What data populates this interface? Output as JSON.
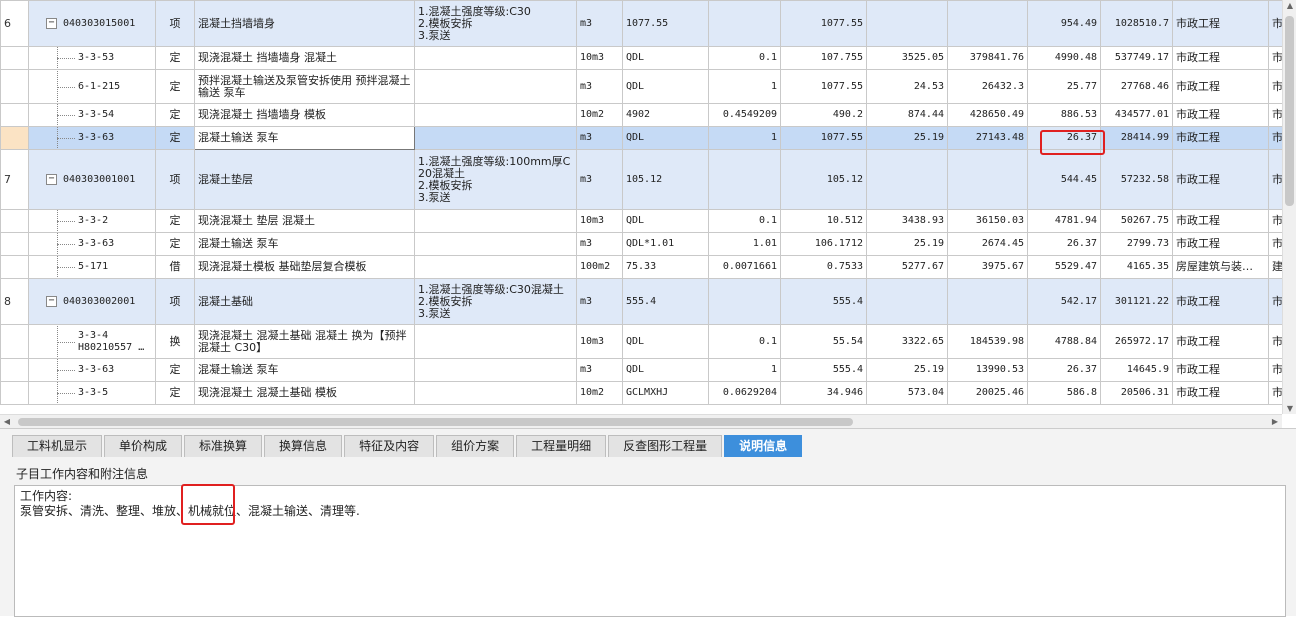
{
  "grid": {
    "rows": [
      {
        "type": "item",
        "rownum": "6",
        "code": "040303015001",
        "kind": "项",
        "name": "混凝土挡墙墙身",
        "features": "1.混凝土强度等级:C30\n2.模板安拆\n3.泵送",
        "unit": "m3",
        "qexpr": "1077.55",
        "coeff": "",
        "qty": "1077.55",
        "price": "",
        "total": "",
        "uprice": "954.49",
        "utotal": "1028510.7",
        "spec": "市政工程",
        "extra": "市"
      },
      {
        "type": "child",
        "rownum": "",
        "code": "3-3-53",
        "kind": "定",
        "name": "现浇混凝土 挡墙墙身 混凝土",
        "features": "",
        "unit": "10m3",
        "qexpr": "QDL",
        "coeff": "0.1",
        "qty": "107.755",
        "price": "3525.05",
        "total": "379841.76",
        "uprice": "4990.48",
        "utotal": "537749.17",
        "spec": "市政工程",
        "extra": "市"
      },
      {
        "type": "child",
        "rownum": "",
        "code": "6-1-215",
        "kind": "定",
        "name": "预拌混凝土输送及泵管安拆使用 预拌混凝土输送 泵车",
        "features": "",
        "unit": "m3",
        "qexpr": "QDL",
        "coeff": "1",
        "qty": "1077.55",
        "price": "24.53",
        "total": "26432.3",
        "uprice": "25.77",
        "utotal": "27768.46",
        "spec": "市政工程",
        "extra": "市"
      },
      {
        "type": "child",
        "rownum": "",
        "code": "3-3-54",
        "kind": "定",
        "name": "现浇混凝土 挡墙墙身 模板",
        "features": "",
        "unit": "10m2",
        "qexpr": "4902",
        "coeff": "0.4549209",
        "qty": "490.2",
        "price": "874.44",
        "total": "428650.49",
        "uprice": "886.53",
        "utotal": "434577.01",
        "spec": "市政工程",
        "extra": "市"
      },
      {
        "type": "selected",
        "rownum": "",
        "code": "3-3-63",
        "kind": "定",
        "name": "混凝土输送 泵车",
        "features": "",
        "unit": "m3",
        "qexpr": "QDL",
        "coeff": "1",
        "qty": "1077.55",
        "price": "25.19",
        "total": "27143.48",
        "uprice": "26.37",
        "utotal": "28414.99",
        "spec": "市政工程",
        "extra": "市"
      },
      {
        "type": "item",
        "rownum": "7",
        "code": "040303001001",
        "kind": "项",
        "name": "混凝土垫层",
        "features": "1.混凝土强度等级:100mm厚C20混凝土\n2.模板安拆\n3.泵送",
        "unit": "m3",
        "qexpr": "105.12",
        "coeff": "",
        "qty": "105.12",
        "price": "",
        "total": "",
        "uprice": "544.45",
        "utotal": "57232.58",
        "spec": "市政工程",
        "extra": "市"
      },
      {
        "type": "child",
        "rownum": "",
        "code": "3-3-2",
        "kind": "定",
        "name": "现浇混凝土 垫层 混凝土",
        "features": "",
        "unit": "10m3",
        "qexpr": "QDL",
        "coeff": "0.1",
        "qty": "10.512",
        "price": "3438.93",
        "total": "36150.03",
        "uprice": "4781.94",
        "utotal": "50267.75",
        "spec": "市政工程",
        "extra": "市"
      },
      {
        "type": "child",
        "rownum": "",
        "code": "3-3-63",
        "kind": "定",
        "name": "混凝土输送 泵车",
        "features": "",
        "unit": "m3",
        "qexpr": "QDL*1.01",
        "coeff": "1.01",
        "qty": "106.1712",
        "price": "25.19",
        "total": "2674.45",
        "uprice": "26.37",
        "utotal": "2799.73",
        "spec": "市政工程",
        "extra": "市"
      },
      {
        "type": "child",
        "rownum": "",
        "code": "5-171",
        "kind": "借",
        "name": "现浇混凝土模板 基础垫层复合模板",
        "features": "",
        "unit": "100m2",
        "qexpr": "75.33",
        "coeff": "0.0071661",
        "qty": "0.7533",
        "price": "5277.67",
        "total": "3975.67",
        "uprice": "5529.47",
        "utotal": "4165.35",
        "spec": "房屋建筑与装…",
        "extra": "建"
      },
      {
        "type": "item",
        "rownum": "8",
        "code": "040303002001",
        "kind": "项",
        "name": "混凝土基础",
        "features": "1.混凝土强度等级:C30混凝土\n2.模板安拆\n3.泵送",
        "unit": "m3",
        "qexpr": "555.4",
        "coeff": "",
        "qty": "555.4",
        "price": "",
        "total": "",
        "uprice": "542.17",
        "utotal": "301121.22",
        "spec": "市政工程",
        "extra": "市"
      },
      {
        "type": "child",
        "rownum": "",
        "code": "3-3-4\nH80210557 …",
        "kind": "换",
        "name": "现浇混凝土 混凝土基础 混凝土  换为【预拌混凝土 C30】",
        "features": "",
        "unit": "10m3",
        "qexpr": "QDL",
        "coeff": "0.1",
        "qty": "55.54",
        "price": "3322.65",
        "total": "184539.98",
        "uprice": "4788.84",
        "utotal": "265972.17",
        "spec": "市政工程",
        "extra": "市"
      },
      {
        "type": "child",
        "rownum": "",
        "code": "3-3-63",
        "kind": "定",
        "name": "混凝土输送 泵车",
        "features": "",
        "unit": "m3",
        "qexpr": "QDL",
        "coeff": "1",
        "qty": "555.4",
        "price": "25.19",
        "total": "13990.53",
        "uprice": "26.37",
        "utotal": "14645.9",
        "spec": "市政工程",
        "extra": "市"
      },
      {
        "type": "child",
        "rownum": "",
        "code": "3-3-5",
        "kind": "定",
        "name": "现浇混凝土 混凝土基础 模板",
        "features": "",
        "unit": "10m2",
        "qexpr": "GCLMXHJ",
        "coeff": "0.0629204",
        "qty": "34.946",
        "price": "573.04",
        "total": "20025.46",
        "uprice": "586.8",
        "utotal": "20506.31",
        "spec": "市政工程",
        "extra": "市"
      }
    ]
  },
  "tabs": [
    "工料机显示",
    "单价构成",
    "标准换算",
    "换算信息",
    "特征及内容",
    "组价方案",
    "工程量明细",
    "反查图形工程量",
    "说明信息"
  ],
  "active_tab": "说明信息",
  "panel": {
    "label": "子目工作内容和附注信息",
    "line1": "工作内容:",
    "line2": "泵管安拆、清洗、整理、堆放、机械就位、混凝土输送、清理等."
  },
  "colors": {
    "highlight": "#e02020",
    "active_tab": "#3d8fdc",
    "item_row": "#dfe9f8",
    "selected_row": "#c5daf5"
  }
}
